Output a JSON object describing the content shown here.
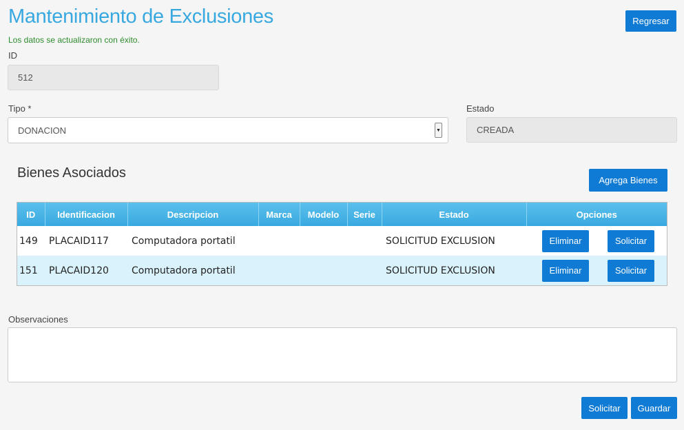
{
  "page": {
    "title": "Mantenimiento de Exclusiones",
    "success_message": "Los datos se actualizaron con éxito.",
    "back_button": "Regresar"
  },
  "form": {
    "id_label": "ID",
    "id_value": "512",
    "tipo_label": "Tipo *",
    "tipo_value": "DONACION",
    "estado_label": "Estado",
    "estado_value": "CREADA",
    "observaciones_label": "Observaciones",
    "observaciones_value": ""
  },
  "bienes": {
    "title": "Bienes Asociados",
    "add_button": "Agrega Bienes",
    "columns": [
      "ID",
      "Identificacion",
      "Descripcion",
      "Marca",
      "Modelo",
      "Serie",
      "Estado",
      "Opciones"
    ],
    "rows": [
      {
        "id": "149",
        "identificacion": "PLACAID117",
        "descripcion": "Computadora portatil",
        "marca": "",
        "modelo": "",
        "serie": "",
        "estado": "SOLICITUD EXCLUSION",
        "eliminar": "Eliminar",
        "solicitar": "Solicitar"
      },
      {
        "id": "151",
        "identificacion": "PLACAID120",
        "descripcion": "Computadora portatil",
        "marca": "",
        "modelo": "",
        "serie": "",
        "estado": "SOLICITUD EXCLUSION",
        "eliminar": "Eliminar",
        "solicitar": "Solicitar"
      }
    ]
  },
  "footer": {
    "solicitar_button": "Solicitar",
    "guardar_button": "Guardar"
  },
  "colors": {
    "accent": "#38a8e0",
    "button": "#0f7bd4",
    "success": "#2e8b2e",
    "row_alt": "#d9f2fb"
  }
}
